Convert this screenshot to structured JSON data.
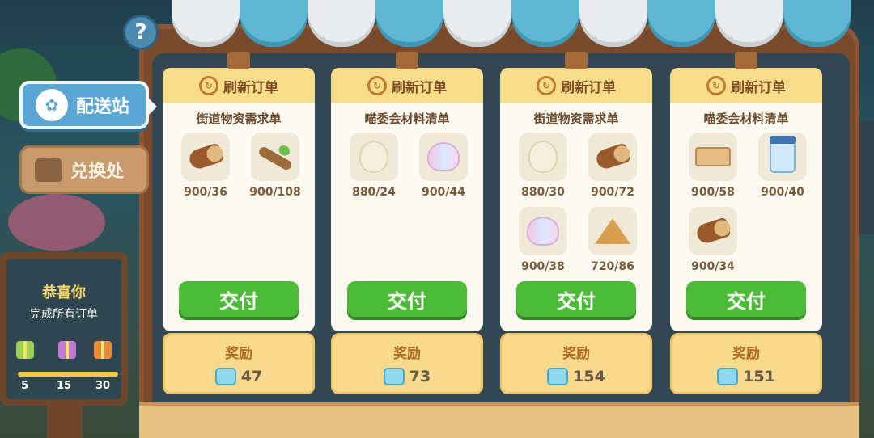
{
  "help": {
    "label": "?"
  },
  "tabs": {
    "delivery": "配送站",
    "exchange": "兑换处"
  },
  "board": {
    "title": "恭喜你",
    "subtitle": "完成所有订单",
    "milestones": [
      "5",
      "15",
      "30"
    ]
  },
  "common": {
    "refresh": "刷新订单",
    "deliver": "交付",
    "reward": "奖励"
  },
  "orders": [
    {
      "name": "街道物资需求单",
      "reward": "47",
      "items": [
        {
          "icon": "log-icon",
          "count": "900/36"
        },
        {
          "icon": "branch-icon",
          "count": "900/108"
        }
      ]
    },
    {
      "name": "喵委会材料清单",
      "reward": "73",
      "items": [
        {
          "icon": "pot-icon",
          "count": "880/24"
        },
        {
          "icon": "shell-icon",
          "count": "900/44"
        }
      ]
    },
    {
      "name": "街道物资需求单",
      "reward": "154",
      "items": [
        {
          "icon": "pot-icon",
          "count": "880/30"
        },
        {
          "icon": "log-icon",
          "count": "900/72"
        },
        {
          "icon": "shell-icon",
          "count": "900/38"
        },
        {
          "icon": "sand-icon",
          "count": "720/86"
        }
      ]
    },
    {
      "name": "喵委会材料清单",
      "reward": "151",
      "items": [
        {
          "icon": "plank-icon",
          "count": "900/58"
        },
        {
          "icon": "jar-icon",
          "count": "900/40"
        },
        {
          "icon": "log-icon",
          "count": "900/34"
        }
      ]
    }
  ],
  "colors": {
    "deliver_green": "#4cbb38",
    "tab_blue": "#5aa7d6",
    "awning_blue": "#5fb7d3"
  }
}
